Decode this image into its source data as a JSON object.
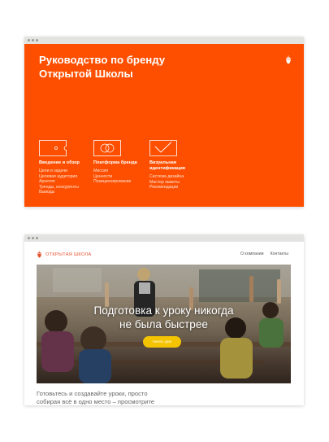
{
  "brand_guide": {
    "title_line1": "Руководство по бренду",
    "title_line2": "Открытой Школы",
    "icon": "acorn-icon",
    "sections": [
      {
        "icon": "ticket-icon",
        "title": "Введение и обзор",
        "items": [
          "Цели и задачи",
          "Целевая аудитория",
          "Архетип",
          "Тренды, конкуренты",
          "Выводы"
        ]
      },
      {
        "icon": "rings-icon",
        "title": "Платформа бренда",
        "items": [
          "Миссия",
          "Ценности",
          "Позиционирование"
        ]
      },
      {
        "icon": "checkmark-icon",
        "title_line1": "Визуальная",
        "title_line2": "идентификация",
        "items": [
          "Система дизайна",
          "Мастер макеты",
          "Рекомендации"
        ]
      }
    ],
    "colors": {
      "accent": "#fe4f00"
    }
  },
  "website": {
    "logo_text": "ОТКРЫТАЯ ШКОЛА",
    "nav": [
      "О компании",
      "Контакты"
    ],
    "hero_title_line1": "Подготовка к уроку никогда",
    "hero_title_line2": "не была быстрее",
    "hero_button": "Начать урок",
    "intro_line1": "Готовьтесь и создавайте уроки, просто",
    "intro_line2": "собирая всё в одно место – просмотрите",
    "colors": {
      "logo": "#e7502e",
      "button": "#f5c400"
    }
  }
}
